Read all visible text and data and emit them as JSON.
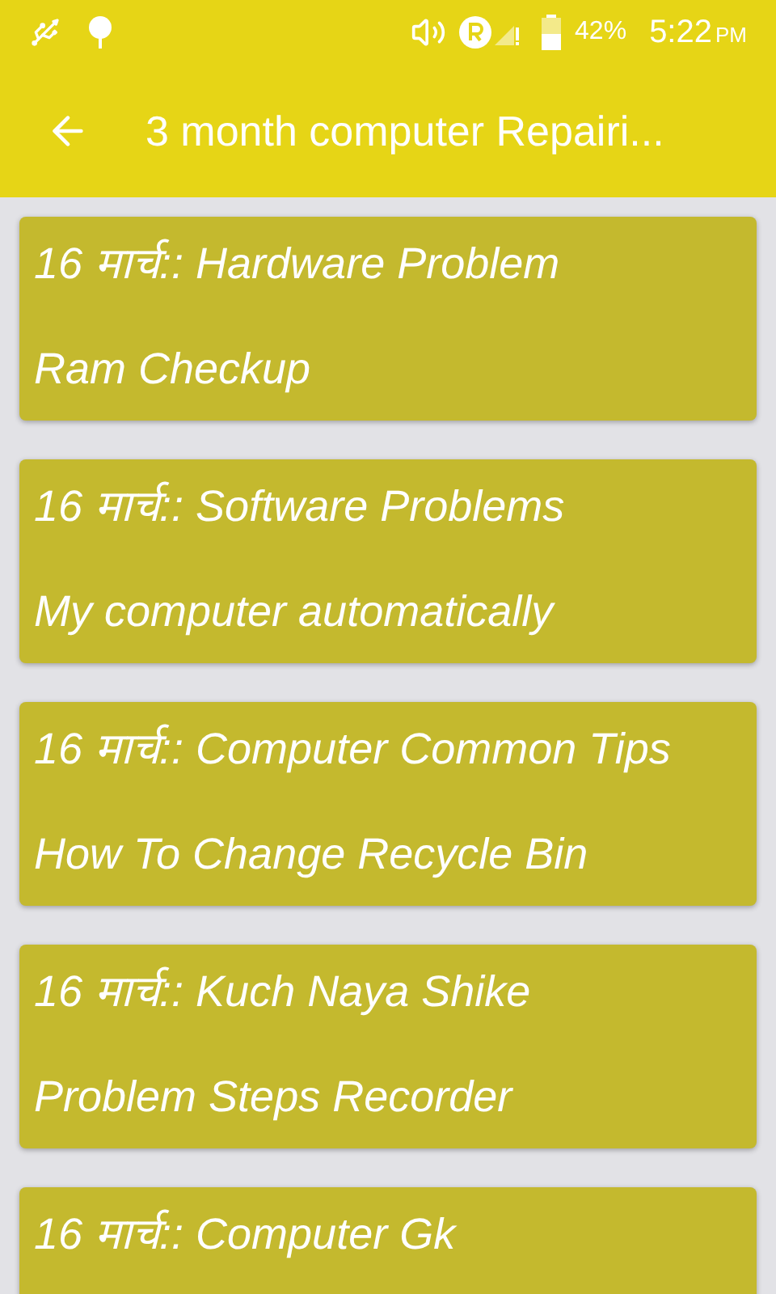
{
  "status_bar": {
    "battery": "42%",
    "time": "5:22",
    "time_suffix": "PM"
  },
  "toolbar": {
    "title": "3 month computer Repairi..."
  },
  "cards": [
    {
      "title": "16 मार्च:: Hardware Problem",
      "subtitle": "Ram Checkup"
    },
    {
      "title": "16 मार्च:: Software Problems",
      "subtitle": "My computer automatically"
    },
    {
      "title": "16 मार्च:: Computer Common Tips",
      "subtitle": "How To Change Recycle Bin"
    },
    {
      "title": "16 मार्च:: Kuch Naya Shike",
      "subtitle": "Problem Steps Recorder"
    },
    {
      "title": "16 मार्च:: Computer Gk"
    }
  ]
}
